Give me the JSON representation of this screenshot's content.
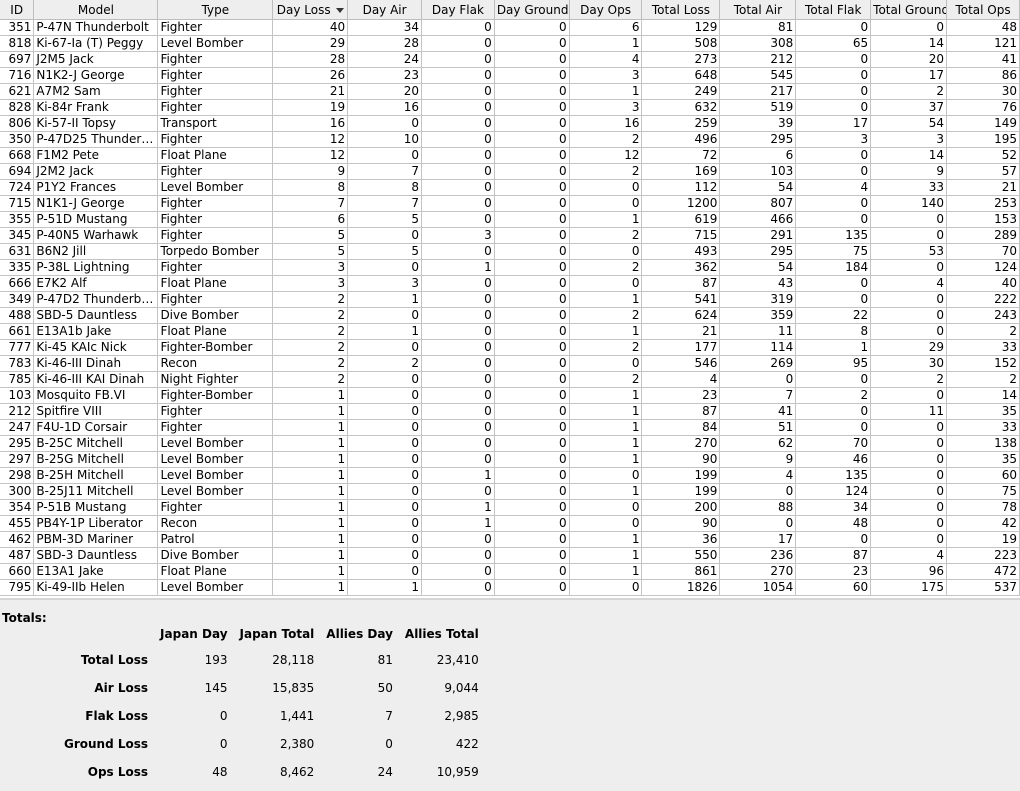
{
  "headers": [
    "ID",
    "Model",
    "Type",
    "Day Loss",
    "Day Air",
    "Day Flak",
    "Day Ground",
    "Day Ops",
    "Total Loss",
    "Total Air",
    "Total Flak",
    "Total Ground",
    "Total Ops"
  ],
  "sort_icon": "sort-descending-icon",
  "rows": [
    [
      "351",
      "P-47N Thunderbolt",
      "Fighter",
      "40",
      "34",
      "0",
      "0",
      "6",
      "129",
      "81",
      "0",
      "0",
      "48"
    ],
    [
      "818",
      "Ki-67-Ia (T) Peggy",
      "Level Bomber",
      "29",
      "28",
      "0",
      "0",
      "1",
      "508",
      "308",
      "65",
      "14",
      "121"
    ],
    [
      "697",
      "J2M5 Jack",
      "Fighter",
      "28",
      "24",
      "0",
      "0",
      "4",
      "273",
      "212",
      "0",
      "20",
      "41"
    ],
    [
      "716",
      "N1K2-J George",
      "Fighter",
      "26",
      "23",
      "0",
      "0",
      "3",
      "648",
      "545",
      "0",
      "17",
      "86"
    ],
    [
      "621",
      "A7M2 Sam",
      "Fighter",
      "21",
      "20",
      "0",
      "0",
      "1",
      "249",
      "217",
      "0",
      "2",
      "30"
    ],
    [
      "828",
      "Ki-84r Frank",
      "Fighter",
      "19",
      "16",
      "0",
      "0",
      "3",
      "632",
      "519",
      "0",
      "37",
      "76"
    ],
    [
      "806",
      "Ki-57-II Topsy",
      "Transport",
      "16",
      "0",
      "0",
      "0",
      "16",
      "259",
      "39",
      "17",
      "54",
      "149"
    ],
    [
      "350",
      "P-47D25 Thunderb...",
      "Fighter",
      "12",
      "10",
      "0",
      "0",
      "2",
      "496",
      "295",
      "3",
      "3",
      "195"
    ],
    [
      "668",
      "F1M2 Pete",
      "Float Plane",
      "12",
      "0",
      "0",
      "0",
      "12",
      "72",
      "6",
      "0",
      "14",
      "52"
    ],
    [
      "694",
      "J2M2 Jack",
      "Fighter",
      "9",
      "7",
      "0",
      "0",
      "2",
      "169",
      "103",
      "0",
      "9",
      "57"
    ],
    [
      "724",
      "P1Y2 Frances",
      "Level Bomber",
      "8",
      "8",
      "0",
      "0",
      "0",
      "112",
      "54",
      "4",
      "33",
      "21"
    ],
    [
      "715",
      "N1K1-J George",
      "Fighter",
      "7",
      "7",
      "0",
      "0",
      "0",
      "1200",
      "807",
      "0",
      "140",
      "253"
    ],
    [
      "355",
      "P-51D Mustang",
      "Fighter",
      "6",
      "5",
      "0",
      "0",
      "1",
      "619",
      "466",
      "0",
      "0",
      "153"
    ],
    [
      "345",
      "P-40N5 Warhawk",
      "Fighter",
      "5",
      "0",
      "3",
      "0",
      "2",
      "715",
      "291",
      "135",
      "0",
      "289"
    ],
    [
      "631",
      "B6N2 Jill",
      "Torpedo Bomber",
      "5",
      "5",
      "0",
      "0",
      "0",
      "493",
      "295",
      "75",
      "53",
      "70"
    ],
    [
      "335",
      "P-38L Lightning",
      "Fighter",
      "3",
      "0",
      "1",
      "0",
      "2",
      "362",
      "54",
      "184",
      "0",
      "124"
    ],
    [
      "666",
      "E7K2 Alf",
      "Float Plane",
      "3",
      "3",
      "0",
      "0",
      "0",
      "87",
      "43",
      "0",
      "4",
      "40"
    ],
    [
      "349",
      "P-47D2 Thunderbolt",
      "Fighter",
      "2",
      "1",
      "0",
      "0",
      "1",
      "541",
      "319",
      "0",
      "0",
      "222"
    ],
    [
      "488",
      "SBD-5 Dauntless",
      "Dive Bomber",
      "2",
      "0",
      "0",
      "0",
      "2",
      "624",
      "359",
      "22",
      "0",
      "243"
    ],
    [
      "661",
      "E13A1b Jake",
      "Float Plane",
      "2",
      "1",
      "0",
      "0",
      "1",
      "21",
      "11",
      "8",
      "0",
      "2"
    ],
    [
      "777",
      "Ki-45 KAIc Nick",
      "Fighter-Bomber",
      "2",
      "0",
      "0",
      "0",
      "2",
      "177",
      "114",
      "1",
      "29",
      "33"
    ],
    [
      "783",
      "Ki-46-III Dinah",
      "Recon",
      "2",
      "2",
      "0",
      "0",
      "0",
      "546",
      "269",
      "95",
      "30",
      "152"
    ],
    [
      "785",
      "Ki-46-III KAI Dinah",
      "Night Fighter",
      "2",
      "0",
      "0",
      "0",
      "2",
      "4",
      "0",
      "0",
      "2",
      "2"
    ],
    [
      "103",
      "Mosquito FB.VI",
      "Fighter-Bomber",
      "1",
      "0",
      "0",
      "0",
      "1",
      "23",
      "7",
      "2",
      "0",
      "14"
    ],
    [
      "212",
      "Spitfire VIII",
      "Fighter",
      "1",
      "0",
      "0",
      "0",
      "1",
      "87",
      "41",
      "0",
      "11",
      "35"
    ],
    [
      "247",
      "F4U-1D Corsair",
      "Fighter",
      "1",
      "0",
      "0",
      "0",
      "1",
      "84",
      "51",
      "0",
      "0",
      "33"
    ],
    [
      "295",
      "B-25C Mitchell",
      "Level Bomber",
      "1",
      "0",
      "0",
      "0",
      "1",
      "270",
      "62",
      "70",
      "0",
      "138"
    ],
    [
      "297",
      "B-25G Mitchell",
      "Level Bomber",
      "1",
      "0",
      "0",
      "0",
      "1",
      "90",
      "9",
      "46",
      "0",
      "35"
    ],
    [
      "298",
      "B-25H Mitchell",
      "Level Bomber",
      "1",
      "0",
      "1",
      "0",
      "0",
      "199",
      "4",
      "135",
      "0",
      "60"
    ],
    [
      "300",
      "B-25J11 Mitchell",
      "Level Bomber",
      "1",
      "0",
      "0",
      "0",
      "1",
      "199",
      "0",
      "124",
      "0",
      "75"
    ],
    [
      "354",
      "P-51B Mustang",
      "Fighter",
      "1",
      "0",
      "1",
      "0",
      "0",
      "200",
      "88",
      "34",
      "0",
      "78"
    ],
    [
      "455",
      "PB4Y-1P Liberator",
      "Recon",
      "1",
      "0",
      "1",
      "0",
      "0",
      "90",
      "0",
      "48",
      "0",
      "42"
    ],
    [
      "462",
      "PBM-3D Mariner",
      "Patrol",
      "1",
      "0",
      "0",
      "0",
      "1",
      "36",
      "17",
      "0",
      "0",
      "19"
    ],
    [
      "487",
      "SBD-3 Dauntless",
      "Dive Bomber",
      "1",
      "0",
      "0",
      "0",
      "1",
      "550",
      "236",
      "87",
      "4",
      "223"
    ],
    [
      "660",
      "E13A1 Jake",
      "Float Plane",
      "1",
      "0",
      "0",
      "0",
      "1",
      "861",
      "270",
      "23",
      "96",
      "472"
    ],
    [
      "795",
      "Ki-49-IIb Helen",
      "Level Bomber",
      "1",
      "1",
      "0",
      "0",
      "0",
      "1826",
      "1054",
      "60",
      "175",
      "537"
    ]
  ],
  "totals": {
    "title": "Totals:",
    "headers": [
      "Japan Day",
      "Japan Total",
      "Allies Day",
      "Allies Total"
    ],
    "rows": [
      {
        "label": "Total Loss",
        "values": [
          "193",
          "28,118",
          "81",
          "23,410"
        ]
      },
      {
        "label": "Air Loss",
        "values": [
          "145",
          "15,835",
          "50",
          "9,044"
        ]
      },
      {
        "label": "Flak Loss",
        "values": [
          "0",
          "1,441",
          "7",
          "2,985"
        ]
      },
      {
        "label": "Ground Loss",
        "values": [
          "0",
          "2,380",
          "0",
          "422"
        ]
      },
      {
        "label": "Ops Loss",
        "values": [
          "48",
          "8,462",
          "24",
          "10,959"
        ]
      }
    ]
  }
}
